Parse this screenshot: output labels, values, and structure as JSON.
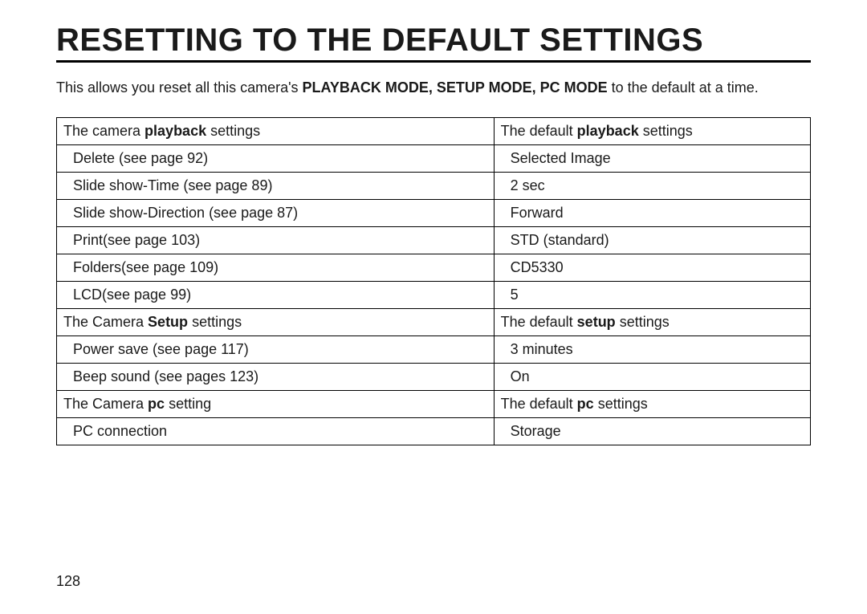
{
  "title": "RESETTING TO THE DEFAULT SETTINGS",
  "intro": {
    "pre": "This allows you reset all this camera's ",
    "bold": "PLAYBACK MODE, SETUP MODE, PC MODE",
    "post": " to the default at a time."
  },
  "table": {
    "rows": [
      {
        "left": {
          "pre": "The camera ",
          "bold": "playback",
          "post": " settings",
          "indent": false
        },
        "right": {
          "pre": "The default ",
          "bold": "playback",
          "post": " settings",
          "indent": false
        }
      },
      {
        "left": {
          "pre": "Delete (see page 92)",
          "bold": "",
          "post": "",
          "indent": true
        },
        "right": {
          "pre": "Selected Image",
          "bold": "",
          "post": "",
          "indent": true
        }
      },
      {
        "left": {
          "pre": "Slide show-Time (see page 89)",
          "bold": "",
          "post": "",
          "indent": true
        },
        "right": {
          "pre": "2 sec",
          "bold": "",
          "post": "",
          "indent": true
        }
      },
      {
        "left": {
          "pre": "Slide show-Direction (see page 87)",
          "bold": "",
          "post": "",
          "indent": true
        },
        "right": {
          "pre": "Forward",
          "bold": "",
          "post": "",
          "indent": true
        }
      },
      {
        "left": {
          "pre": "Print(see page 103)",
          "bold": "",
          "post": "",
          "indent": true
        },
        "right": {
          "pre": "STD (standard)",
          "bold": "",
          "post": "",
          "indent": true
        }
      },
      {
        "left": {
          "pre": "Folders(see page 109)",
          "bold": "",
          "post": "",
          "indent": true
        },
        "right": {
          "pre": "CD5330",
          "bold": "",
          "post": "",
          "indent": true
        }
      },
      {
        "left": {
          "pre": "LCD(see page 99)",
          "bold": "",
          "post": "",
          "indent": true
        },
        "right": {
          "pre": "5",
          "bold": "",
          "post": "",
          "indent": true
        }
      },
      {
        "left": {
          "pre": "The Camera ",
          "bold": "Setup",
          "post": " settings",
          "indent": false
        },
        "right": {
          "pre": "The default ",
          "bold": "setup",
          "post": " settings",
          "indent": false
        }
      },
      {
        "left": {
          "pre": "Power save (see page 117)",
          "bold": "",
          "post": "",
          "indent": true
        },
        "right": {
          "pre": "3 minutes",
          "bold": "",
          "post": "",
          "indent": true
        }
      },
      {
        "left": {
          "pre": "Beep sound (see pages 123)",
          "bold": "",
          "post": "",
          "indent": true
        },
        "right": {
          "pre": "On",
          "bold": "",
          "post": "",
          "indent": true
        }
      },
      {
        "left": {
          "pre": "The Camera ",
          "bold": "pc",
          "post": " setting",
          "indent": false
        },
        "right": {
          "pre": "The default ",
          "bold": "pc",
          "post": " settings",
          "indent": false
        }
      },
      {
        "left": {
          "pre": "PC connection",
          "bold": "",
          "post": "",
          "indent": true
        },
        "right": {
          "pre": "Storage",
          "bold": "",
          "post": "",
          "indent": true
        }
      }
    ]
  },
  "page_number": "128"
}
